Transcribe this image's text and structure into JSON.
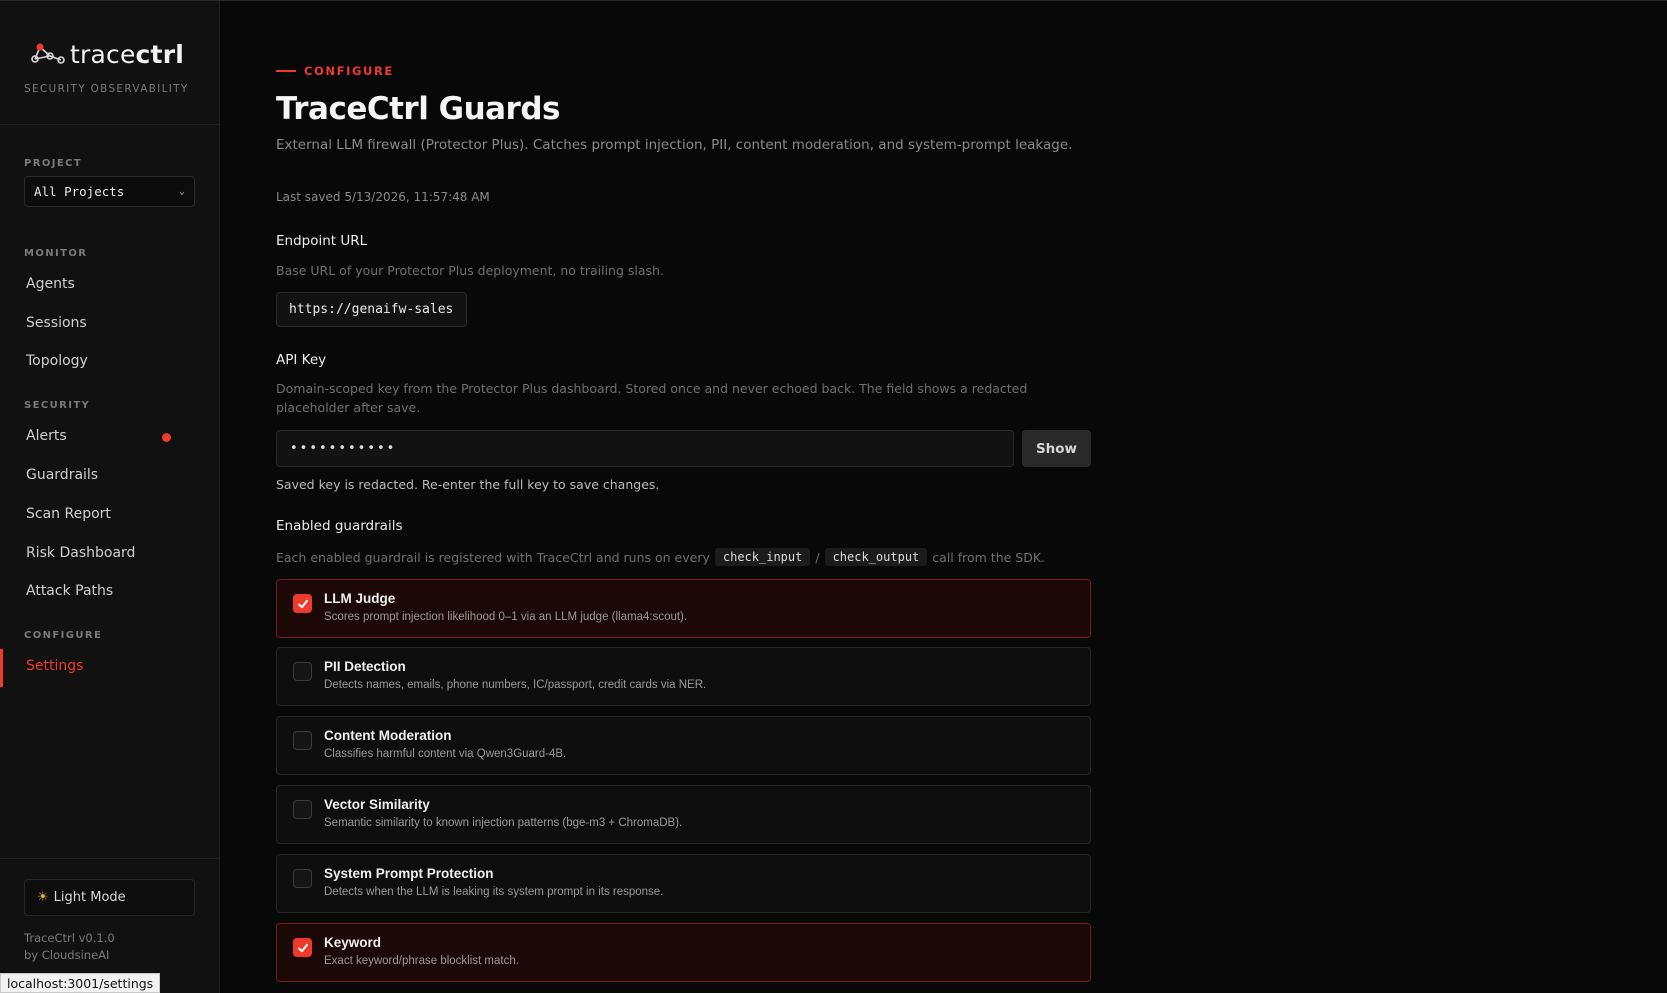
{
  "sidebar": {
    "brand_light": "trace",
    "brand_bold": "ctrl",
    "tagline": "SECURITY OBSERVABILITY",
    "project_label": "PROJECT",
    "project_value": "All Projects",
    "monitor_label": "MONITOR",
    "monitor_items": [
      "Agents",
      "Sessions",
      "Topology"
    ],
    "security_label": "SECURITY",
    "security_items": [
      "Alerts",
      "Guardrails",
      "Scan Report",
      "Risk Dashboard",
      "Attack Paths"
    ],
    "configure_label": "CONFIGURE",
    "configure_items": [
      "Settings"
    ],
    "active_item": "Settings",
    "mode_toggle": "Light Mode",
    "version": "TraceCtrl v0.1.0",
    "by": "by CloudsineAI"
  },
  "status_url": "localhost:3001/settings",
  "main": {
    "eyebrow": "CONFIGURE",
    "title": "TraceCtrl Guards",
    "subtitle": "External LLM firewall (Protector Plus). Catches prompt injection, PII, content moderation, and system-prompt leakage.",
    "last_saved": "Last saved 5/13/2026, 11:57:48 AM",
    "endpoint": {
      "label": "Endpoint URL",
      "help": "Base URL of your Protector Plus deployment, no trailing slash.",
      "value": "https://genaifw-sales"
    },
    "api_key": {
      "label": "API Key",
      "help": "Domain-scoped key from the Protector Plus dashboard. Stored once and never echoed back. The field shows a redacted placeholder after save.",
      "value": "•••••••••••",
      "show_button": "Show",
      "note": "Saved key is redacted. Re-enter the full key to save changes."
    },
    "guardrails": {
      "label": "Enabled guardrails",
      "help_prefix": "Each enabled guardrail is registered with TraceCtrl and runs on every",
      "code_input": "check_input",
      "separator": "/",
      "code_output": "check_output",
      "help_suffix": "call from the SDK.",
      "items": [
        {
          "title": "LLM Judge",
          "desc": "Scores prompt injection likelihood 0–1 via an LLM judge (llama4:scout).",
          "enabled": true
        },
        {
          "title": "PII Detection",
          "desc": "Detects names, emails, phone numbers, IC/passport, credit cards via NER.",
          "enabled": false
        },
        {
          "title": "Content Moderation",
          "desc": "Classifies harmful content via Qwen3Guard-4B.",
          "enabled": false
        },
        {
          "title": "Vector Similarity",
          "desc": "Semantic similarity to known injection patterns (bge-m3 + ChromaDB).",
          "enabled": false
        },
        {
          "title": "System Prompt Protection",
          "desc": "Detects when the LLM is leaking its system prompt in its response.",
          "enabled": false
        },
        {
          "title": "Keyword",
          "desc": "Exact keyword/phrase blocklist match.",
          "enabled": true
        }
      ]
    }
  },
  "colors": {
    "accent": "#ef3b2c",
    "background": "#080808",
    "sidebar": "#111111"
  }
}
